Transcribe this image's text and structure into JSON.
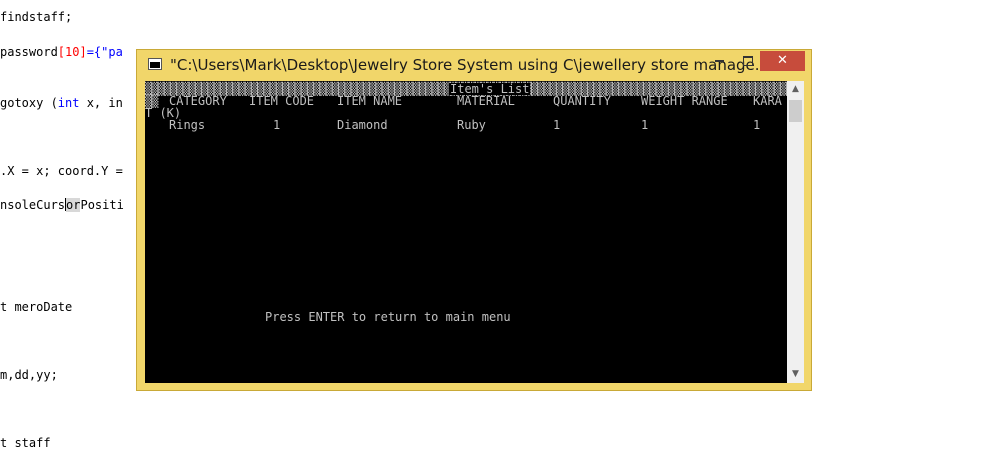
{
  "editor": {
    "lines": [
      {
        "pre": "findstaff;"
      },
      {
        "pre": "password",
        "num": "[10]",
        "post": "={\"pa",
        "str": "",
        "tail": "\"}"
      },
      {
        "pre": "gotoxy (",
        "kw": "int",
        "post": " x, in"
      },
      {
        "pre": ".X = x; coord.Y ="
      },
      {
        "pre": "nsoleCurs",
        "sel": "or",
        "post": "Positi"
      },
      {
        "pre": "t meroDate"
      },
      {
        "pre": "m,dd,yy;"
      },
      {
        "pre": "t staff"
      }
    ]
  },
  "window": {
    "title": "\"C:\\Users\\Mark\\Desktop\\Jewelry Store System using C\\jewellery store manage...",
    "minimize_label": "",
    "maximize_label": "",
    "close_label": "✕"
  },
  "console": {
    "header_title": "Item's List",
    "columns": [
      "CATEGORY",
      "ITEM CODE",
      "ITEM NAME",
      "MATERIAL",
      "QUANTITY",
      "WEIGHT RANGE",
      "KARA"
    ],
    "wrap": "T (K)",
    "row": [
      "Rings",
      "1",
      "Diamond",
      "Ruby",
      "1",
      "1",
      "1"
    ],
    "prompt": "Press ENTER to return to main menu"
  },
  "scrollbar": {
    "up_icon": "▲",
    "down_icon": "▼"
  }
}
